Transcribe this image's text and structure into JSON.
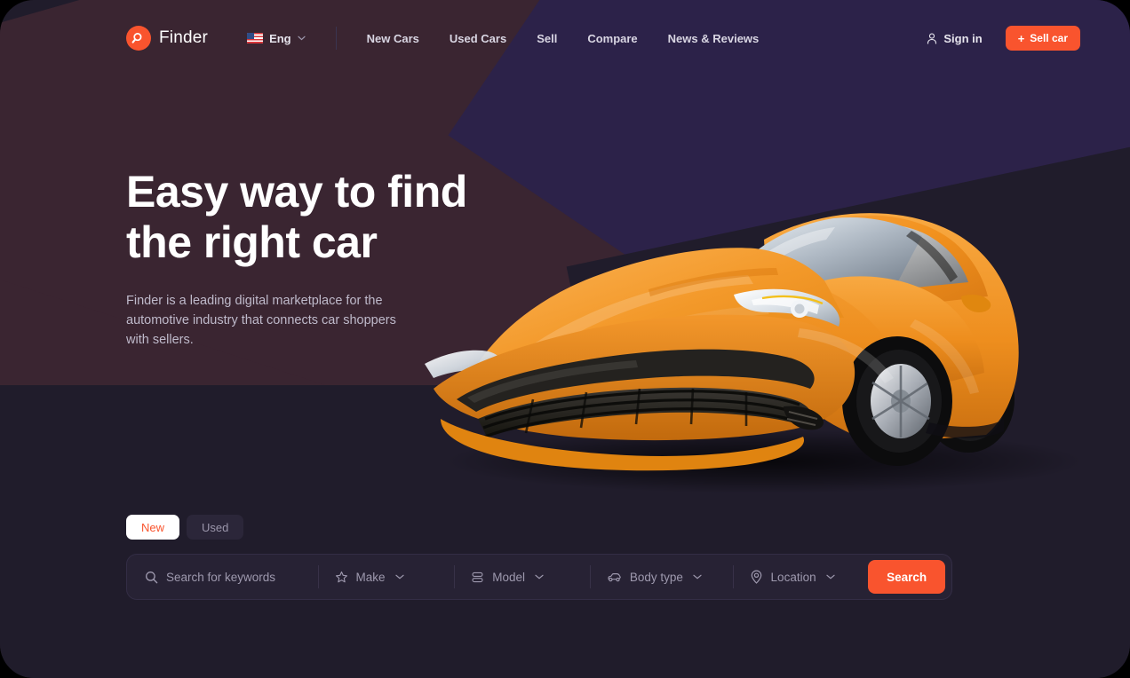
{
  "brand": {
    "name": "Finder",
    "logo_icon": "search-circle-icon",
    "accent_color": "#F9542E"
  },
  "theme": {
    "background": "#201C2B",
    "maroon_shape": "#3A2531",
    "purple_shape": "#2C2249",
    "searchbar_bg": "#272234",
    "text_primary": "#FFFFFF",
    "text_muted": "#9E99AE"
  },
  "header": {
    "language": {
      "label": "Eng",
      "flag_icon": "us-flag-icon",
      "chevron_icon": "chevron-down-icon"
    },
    "nav": [
      {
        "label": "New Cars"
      },
      {
        "label": "Used Cars"
      },
      {
        "label": "Sell"
      },
      {
        "label": "Compare"
      },
      {
        "label": "News & Reviews"
      }
    ],
    "sign_in": {
      "label": "Sign in",
      "icon": "user-icon"
    },
    "sell_car": {
      "label": "Sell car",
      "icon": "plus-icon",
      "plus": "+"
    }
  },
  "hero": {
    "title_line1": "Easy way to find",
    "title_line2": "the right car",
    "subtitle": "Finder is a leading digital marketplace for the automotive industry that connects car shoppers with sellers.",
    "image_alt": "orange sports coupe three-quarter front view"
  },
  "condition_tabs": [
    {
      "label": "New",
      "active": true
    },
    {
      "label": "Used",
      "active": false
    }
  ],
  "search": {
    "keywords": {
      "placeholder": "Search for keywords",
      "value": "",
      "icon": "search-icon"
    },
    "make": {
      "label": "Make",
      "icon": "star-icon",
      "chevron": "chevron-down-icon"
    },
    "model": {
      "label": "Model",
      "icon": "layers-icon",
      "chevron": "chevron-down-icon"
    },
    "body_type": {
      "label": "Body type",
      "icon": "car-icon",
      "chevron": "chevron-down-icon"
    },
    "location": {
      "label": "Location",
      "icon": "map-pin-icon",
      "chevron": "chevron-down-icon"
    },
    "submit": {
      "label": "Search"
    }
  }
}
